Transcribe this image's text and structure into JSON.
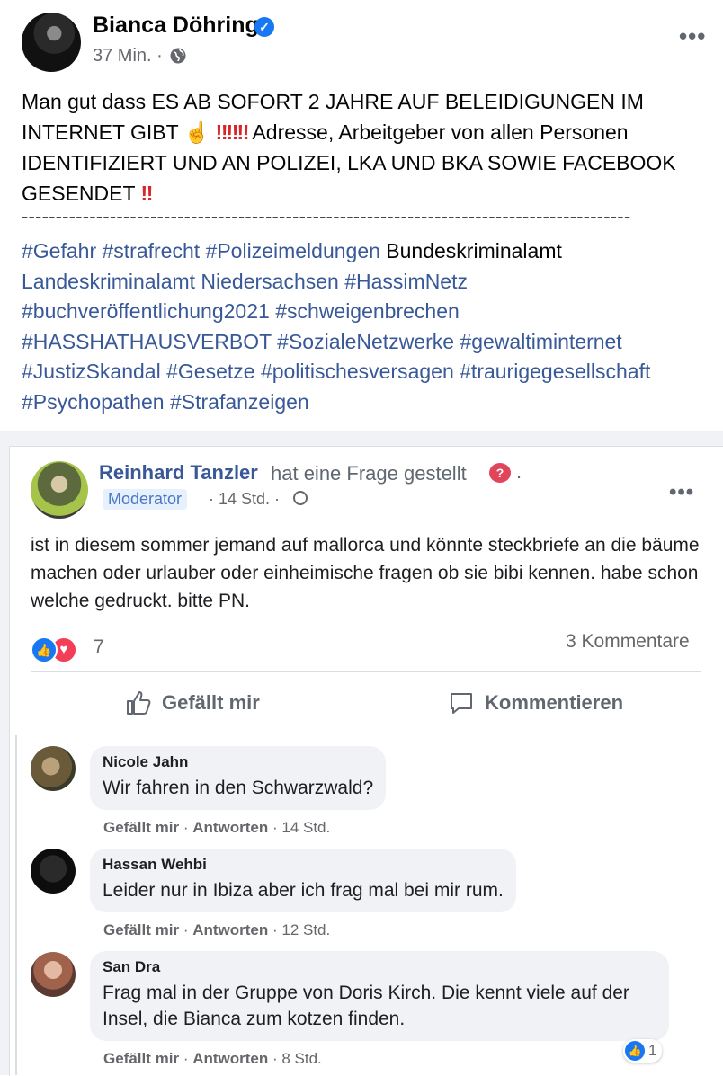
{
  "post": {
    "author": "Bianca Döhring",
    "time": "37 Min.",
    "meta_sep": "·",
    "text_part1": "Man gut dass ES AB SOFORT 2 JAHRE AUF BELEIDIGUNGEN IM INTERNET GIBT",
    "emoji_hand": "☝",
    "bangs1": "‼‼‼",
    "text_part2": "Adresse, Arbeitgeber von allen Personen IDENTIFIZIERT UND AN POLIZEI, LKA UND BKA SOWIE FACEBOOK GESENDET",
    "bangs2": "‼",
    "separator": "------------------------------------------------------------------------------------------",
    "tags": {
      "t1": "#Gefahr",
      "t2": "#strafrecht",
      "t3": "#Polizeimeldungen",
      "plain1": "Bundeskriminalamt",
      "t4": "Landeskriminalamt Niedersachsen",
      "t5": "#HassimNetz",
      "t6": "#buchveröffentlichung2021",
      "t7": "#schweigenbrechen",
      "t8": "#HASSHATHAUSVERBOT",
      "t9": "#SozialeNetzwerke",
      "t10": "#gewaltiminternet",
      "t11": "#JustizSkandal",
      "t12": "#Gesetze",
      "t13": "#politischesversagen",
      "t14": "#traurigegesellschaft",
      "t15": "#Psychopathen",
      "t16": "#Strafanzeigen"
    }
  },
  "shared": {
    "author": "Reinhard Tanzler",
    "action": "hat eine Frage gestellt",
    "badge": "Moderator",
    "time": "· 14 Std. ·",
    "dot": ".",
    "text": "ist in diesem sommer jemand auf mallorca und könnte steckbriefe an die bäume machen oder urlauber oder einheimische fragen ob sie bibi kennen. habe schon welche gedruckt. bitte PN.",
    "reaction_count": "7",
    "comment_count": "3 Kommentare",
    "like_label": "Gefällt mir",
    "comment_label": "Kommentieren"
  },
  "comments": [
    {
      "name": "Nicole Jahn",
      "text": "Wir fahren in den Schwarzwald?",
      "like": "Gefällt mir",
      "reply": "Antworten",
      "time": "14 Std."
    },
    {
      "name": "Hassan Wehbi",
      "text": "Leider nur in Ibiza aber ich frag mal bei mir rum.",
      "like": "Gefällt mir",
      "reply": "Antworten",
      "time": "12 Std."
    },
    {
      "name": "San Dra",
      "text": "Frag mal in der Gruppe von Doris Kirch. Die kennt viele auf der Insel, die Bianca zum kotzen finden.",
      "like": "Gefällt mir",
      "reply": "Antworten",
      "time": "8 Std.",
      "reactions": "1"
    }
  ],
  "colors": {
    "link": "#385898",
    "accent": "#1877f2",
    "alert": "#d8252a"
  }
}
